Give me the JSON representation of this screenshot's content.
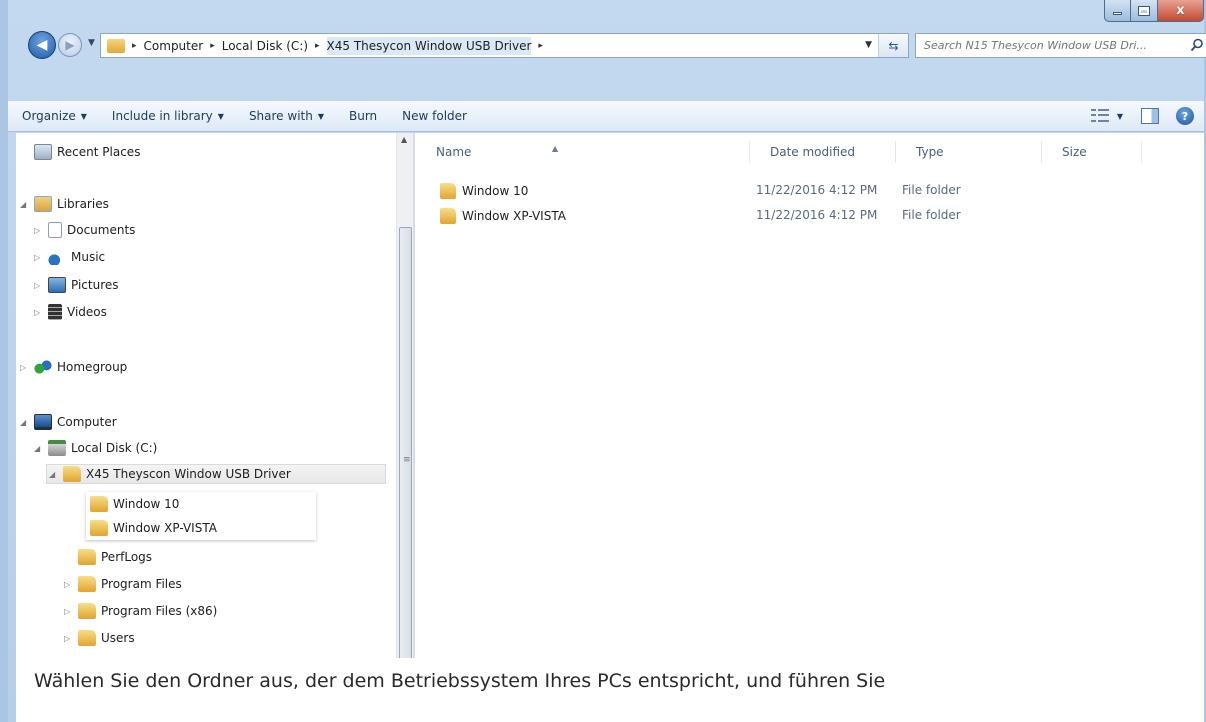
{
  "window": {
    "minimize_glyph": "_",
    "maximize_glyph": "□",
    "close_glyph": "x"
  },
  "address_bar": {
    "crumbs": [
      "Computer",
      "Local Disk (C:)",
      "X45 Thesycon Window USB Driver"
    ],
    "crumb_separator": "▸",
    "search_placeholder": "Search N15 Thesycon Window USB Dri..."
  },
  "toolbar": {
    "organize": "Organize",
    "include_in_library": "Include in library",
    "share_with": "Share with",
    "burn": "Burn",
    "new_folder": "New folder"
  },
  "nav_tree": {
    "recent_places": "Recent Places",
    "libraries": "Libraries",
    "documents": "Documents",
    "music": "Music",
    "pictures": "Pictures",
    "videos": "Videos",
    "homegroup": "Homegroup",
    "computer": "Computer",
    "local_disk": "Local Disk (C:)",
    "driver_folder": "X45 Theyscon Window USB Driver",
    "window10": "Window 10",
    "windowxp": "Window XP-VISTA",
    "perflogs": "PerfLogs",
    "program_files": "Program Files",
    "program_files_x86": "Program Files (x86)",
    "users": "Users"
  },
  "file_list": {
    "columns": {
      "name": "Name",
      "date": "Date modified",
      "type": "Type",
      "size": "Size"
    },
    "rows": [
      {
        "name": "Window 10",
        "date": "11/22/2016 4:12 PM",
        "type": "File folder"
      },
      {
        "name": "Window XP-VISTA",
        "date": "11/22/2016 4:12 PM",
        "type": "File folder"
      }
    ]
  },
  "caption": "Wählen Sie den Ordner aus, der dem Betriebssystem Ihres PCs entspricht, und führen Sie"
}
